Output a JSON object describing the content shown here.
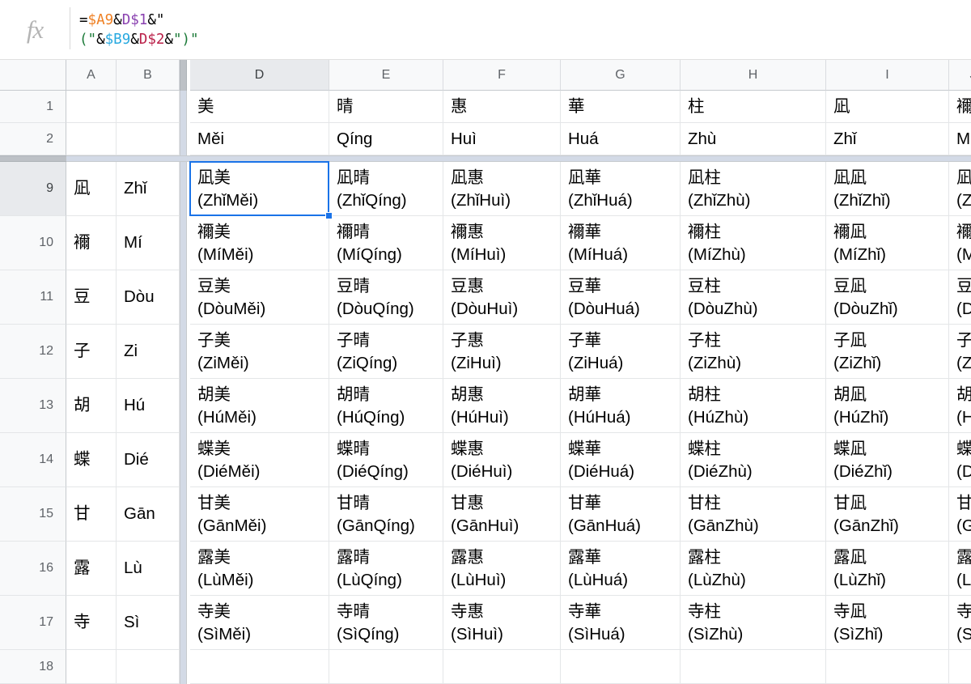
{
  "formula_bar": {
    "fx_label": "fx",
    "formula": "=$A9&D$1&\"\n(\"&$B9&D$2&\")\"",
    "tokens_line1": [
      {
        "text": "=",
        "color": "#000000"
      },
      {
        "text": "$A9",
        "color": "#ef8023"
      },
      {
        "text": "&",
        "color": "#000000"
      },
      {
        "text": "D$1",
        "color": "#8a42b0"
      },
      {
        "text": "&",
        "color": "#000000"
      },
      {
        "text": "\"",
        "color": "#000000"
      }
    ],
    "tokens_line2": [
      {
        "text": "(\"",
        "color": "#1b7a38"
      },
      {
        "text": "&",
        "color": "#000000"
      },
      {
        "text": "$B9",
        "color": "#28a9e0"
      },
      {
        "text": "&",
        "color": "#000000"
      },
      {
        "text": "D$2",
        "color": "#ba2049"
      },
      {
        "text": "&",
        "color": "#000000"
      },
      {
        "text": "\")\"",
        "color": "#1b7a38"
      }
    ]
  },
  "grid": {
    "column_headers": [
      "A",
      "B",
      "D",
      "E",
      "F",
      "G",
      "H",
      "I",
      "J"
    ],
    "active_column": "D",
    "hidden_columns_after": "B",
    "row_headers": [
      "1",
      "2",
      "9",
      "10",
      "11",
      "12",
      "13",
      "14",
      "15",
      "16",
      "17",
      "18"
    ],
    "active_row": "9",
    "hidden_rows_after": "2",
    "selected_cell": "D9",
    "header_row_1": {
      "A": "",
      "B": "",
      "D": "美",
      "E": "晴",
      "F": "惠",
      "G": "華",
      "H": "柱",
      "I": "凪",
      "J": "襧"
    },
    "header_row_2": {
      "A": "",
      "B": "",
      "D": "Měi",
      "E": "Qíng",
      "F": "Huì",
      "G": "Huá",
      "H": "Zhù",
      "I": "Zhǐ",
      "J": "Mí"
    },
    "rows": [
      {
        "num": "9",
        "A": "凪",
        "B": "Zhǐ",
        "D": "凪美\n(ZhǐMěi)",
        "E": "凪晴\n(ZhǐQíng)",
        "F": "凪惠\n(ZhǐHuì)",
        "G": "凪華\n(ZhǐHuá)",
        "H": "凪柱\n(ZhǐZhù)",
        "I": "凪凪\n(ZhǐZhǐ)",
        "J": "凪襧\n(ZhǐMí)"
      },
      {
        "num": "10",
        "A": "襧",
        "B": "Mí",
        "D": "襧美\n(MíMěi)",
        "E": "襧晴\n(MíQíng)",
        "F": "襧惠\n(MíHuì)",
        "G": "襧華\n(MíHuá)",
        "H": "襧柱\n(MíZhù)",
        "I": "襧凪\n(MíZhǐ)",
        "J": "襧襧\n(MíMí)"
      },
      {
        "num": "11",
        "A": "豆",
        "B": "Dòu",
        "D": "豆美\n(DòuMěi)",
        "E": "豆晴\n(DòuQíng)",
        "F": "豆惠\n(DòuHuì)",
        "G": "豆華\n(DòuHuá)",
        "H": "豆柱\n(DòuZhù)",
        "I": "豆凪\n(DòuZhǐ)",
        "J": "豆襧\n(DòuMí)"
      },
      {
        "num": "12",
        "A": "子",
        "B": "Zi",
        "D": "子美\n(ZiMěi)",
        "E": "子晴\n(ZiQíng)",
        "F": "子惠\n(ZiHuì)",
        "G": "子華\n(ZiHuá)",
        "H": "子柱\n(ZiZhù)",
        "I": "子凪\n(ZiZhǐ)",
        "J": "子襧\n(ZiMí)"
      },
      {
        "num": "13",
        "A": "胡",
        "B": "Hú",
        "D": "胡美\n(HúMěi)",
        "E": "胡晴\n(HúQíng)",
        "F": "胡惠\n(HúHuì)",
        "G": "胡華\n(HúHuá)",
        "H": "胡柱\n(HúZhù)",
        "I": "胡凪\n(HúZhǐ)",
        "J": "胡襧\n(HúMí)"
      },
      {
        "num": "14",
        "A": "蝶",
        "B": "Dié",
        "D": "蝶美\n(DiéMěi)",
        "E": "蝶晴\n(DiéQíng)",
        "F": "蝶惠\n(DiéHuì)",
        "G": "蝶華\n(DiéHuá)",
        "H": "蝶柱\n(DiéZhù)",
        "I": "蝶凪\n(DiéZhǐ)",
        "J": "蝶襧\n(DiéMí)"
      },
      {
        "num": "15",
        "A": "甘",
        "B": "Gān",
        "D": "甘美\n(GānMěi)",
        "E": "甘晴\n(GānQíng)",
        "F": "甘惠\n(GānHuì)",
        "G": "甘華\n(GānHuá)",
        "H": "甘柱\n(GānZhù)",
        "I": "甘凪\n(GānZhǐ)",
        "J": "甘襧\n(GānMí)"
      },
      {
        "num": "16",
        "A": "露",
        "B": "Lù",
        "D": "露美\n(LùMěi)",
        "E": "露晴\n(LùQíng)",
        "F": "露惠\n(LùHuì)",
        "G": "露華\n(LùHuá)",
        "H": "露柱\n(LùZhù)",
        "I": "露凪\n(LùZhǐ)",
        "J": "露襧\n(LùMí)"
      },
      {
        "num": "17",
        "A": "寺",
        "B": "Sì",
        "D": "寺美\n(SìMěi)",
        "E": "寺晴\n(SìQíng)",
        "F": "寺惠\n(SìHuì)",
        "G": "寺華\n(SìHuá)",
        "H": "寺柱\n(SìZhù)",
        "I": "寺凪\n(SìZhǐ)",
        "J": "寺襧\n(SìMí)"
      },
      {
        "num": "18",
        "A": "",
        "B": "",
        "D": "",
        "E": "",
        "F": "",
        "G": "",
        "H": "",
        "I": "",
        "J": ""
      }
    ]
  },
  "colors": {
    "selection": "#1a73e8",
    "header_bg": "#f8f9fa",
    "header_active_bg": "#e8eaed",
    "hidden_band": "#d3dae6",
    "gridline": "#e4e6e8"
  }
}
